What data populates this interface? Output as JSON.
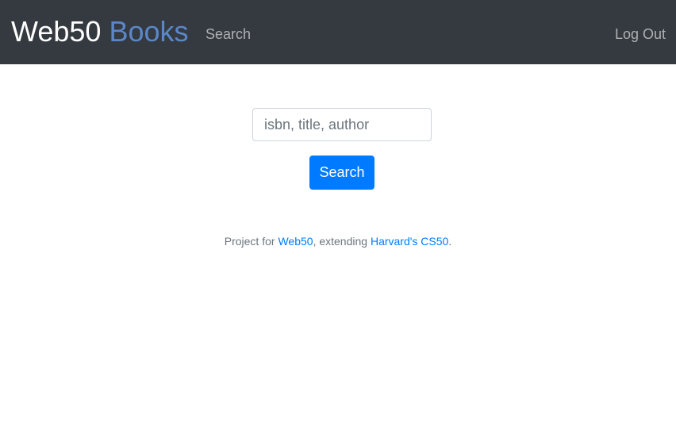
{
  "navbar": {
    "brand_primary": "Web50",
    "brand_accent": "Books",
    "links": [
      {
        "label": "Search"
      },
      {
        "label": "Log Out"
      }
    ]
  },
  "search": {
    "placeholder": "isbn, title, author",
    "value": "",
    "button_label": "Search"
  },
  "footer": {
    "prefix": "Project for ",
    "link1": "Web50",
    "middle": ", extending ",
    "link2": "Harvard's CS50",
    "suffix": "."
  },
  "colors": {
    "navbar_bg": "#343a40",
    "brand_accent": "#5b87c9",
    "primary": "#007bff",
    "muted_text": "#6c757d"
  }
}
